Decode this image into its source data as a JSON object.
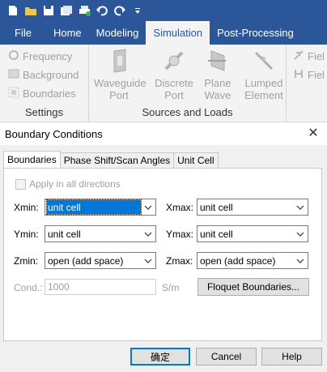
{
  "quick_access": {
    "icons": [
      "new-file-icon",
      "open-folder-icon",
      "save-icon",
      "save-all-icon",
      "print-icon",
      "undo-icon",
      "redo-icon",
      "customize-icon"
    ]
  },
  "menu_tabs": [
    {
      "label": "File"
    },
    {
      "label": "Home"
    },
    {
      "label": "Modeling"
    },
    {
      "label": "Simulation",
      "active": true
    },
    {
      "label": "Post-Processing"
    }
  ],
  "ribbon": {
    "settings": {
      "items": [
        "Frequency",
        "Background",
        "Boundaries"
      ],
      "group_label": "Settings"
    },
    "sources": {
      "buttons": [
        {
          "line1": "Waveguide",
          "line2": "Port"
        },
        {
          "line1": "Discrete",
          "line2": "Port"
        },
        {
          "line1": "Plane",
          "line2": "Wave"
        },
        {
          "line1": "Lumped",
          "line2": "Element"
        }
      ],
      "group_label": "Sources and Loads"
    },
    "field": {
      "items": [
        "Fiel",
        "Fiel"
      ]
    }
  },
  "dialog": {
    "title": "Boundary Conditions",
    "tabs": [
      {
        "label": "Boundaries",
        "active": true
      },
      {
        "label": "Phase Shift/Scan Angles"
      },
      {
        "label": "Unit Cell"
      }
    ],
    "apply_all_label": "Apply in all directions",
    "fields": {
      "xmin": {
        "label": "Xmin:",
        "value": "unit cell"
      },
      "xmax": {
        "label": "Xmax:",
        "value": "unit cell"
      },
      "ymin": {
        "label": "Ymin:",
        "value": "unit cell"
      },
      "ymax": {
        "label": "Ymax:",
        "value": "unit cell"
      },
      "zmin": {
        "label": "Zmin:",
        "value": "open (add space)"
      },
      "zmax": {
        "label": "Zmax:",
        "value": "open (add space)"
      }
    },
    "cond": {
      "label": "Cond.:",
      "value": "1000",
      "unit": "S/m"
    },
    "floquet_label": "Floquet Boundaries...",
    "buttons": {
      "ok": "确定",
      "cancel": "Cancel",
      "help": "Help"
    }
  },
  "colors": {
    "ribbon_blue": "#2b579a",
    "selection": "#0078d7"
  }
}
